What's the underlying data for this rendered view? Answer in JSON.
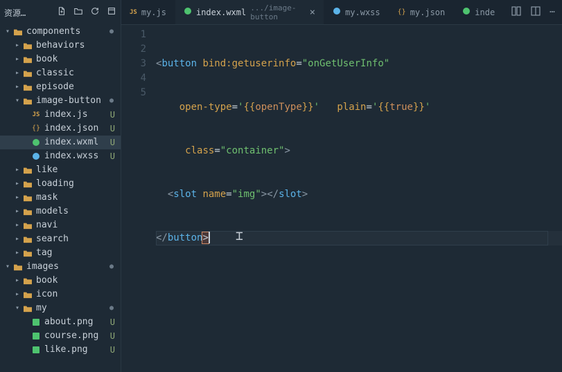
{
  "sidebar": {
    "title": "资源…",
    "tree": {
      "components": "components",
      "behaviors": "behaviors",
      "book": "book",
      "classic": "classic",
      "episode": "episode",
      "image_button": "image-button",
      "index_js": "index.js",
      "index_json": "index.json",
      "index_wxml": "index.wxml",
      "index_wxss": "index.wxss",
      "like": "like",
      "loading": "loading",
      "mask": "mask",
      "models": "models",
      "navi": "navi",
      "search": "search",
      "tag": "tag",
      "images": "images",
      "book2": "book",
      "icon": "icon",
      "my": "my",
      "about_png": "about.png",
      "course_png": "course.png",
      "like_png": "like.png"
    },
    "status_u": "U"
  },
  "tabs": {
    "t1": "my.js",
    "t2": "index.wxml",
    "t2_path": ".../image-button",
    "t3": "my.wxss",
    "t4": "my.json",
    "t5": "inde"
  },
  "code": {
    "line1_a": "<button",
    "line1_attr": " bind:getuserinfo",
    "line1_eq": "=",
    "line1_val": "\"onGetUserInfo\"",
    "line2_attr": "open-type",
    "line2_eq": "=",
    "line2_q1": "'",
    "line2_b1": "{{",
    "line2_v1": "openType",
    "line2_b2": "}}",
    "line2_q2": "'",
    "line2_attr2": "plain",
    "line2_eq2": "=",
    "line2_q3": "'",
    "line2_b3": "{{",
    "line2_v2": "true",
    "line2_b4": "}}",
    "line2_q4": "'",
    "line3_attr": "class",
    "line3_eq": "=",
    "line3_val": "\"container\"",
    "line3_close": ">",
    "line4_a": "<slot",
    "line4_attr": " name",
    "line4_eq": "=",
    "line4_val": "\"img\"",
    "line4_mid": ">",
    "line4_b": "</slot>",
    "line5": "</button>"
  },
  "line_numbers": [
    "1",
    "2",
    "3",
    "4",
    "5"
  ]
}
